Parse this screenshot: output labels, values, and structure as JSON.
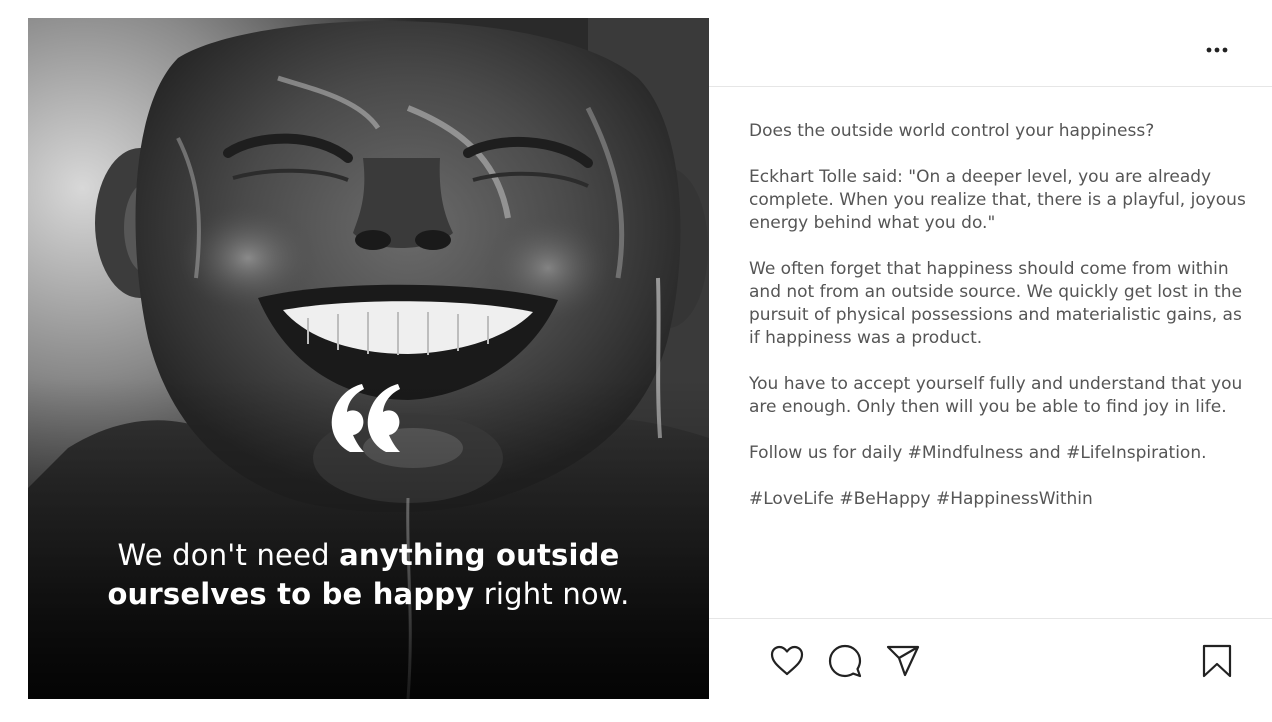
{
  "image": {
    "quote_parts": [
      {
        "text": "We don't need ",
        "weight": "light"
      },
      {
        "text": "anything outside",
        "weight": "bold"
      },
      {
        "text": "ourselves to be happy",
        "weight": "bold"
      },
      {
        "text": " right now.",
        "weight": "light"
      }
    ],
    "quote_icon": "quotation-mark-icon"
  },
  "post": {
    "menu_icon": "more-options-icon",
    "caption": [
      "Does the outside world control your happiness?",
      "Eckhart Tolle said: \"On a deeper level, you are already complete. When you realize that, there is a playful, joyous energy behind what you do.\"",
      "We often forget that happiness should come from within and not from an outside source. We quickly get lost in the pursuit of physical possessions and materialistic gains, as if happiness was a product.",
      "You have to accept yourself fully and understand that you are enough. Only then will you be able to find joy in life.",
      "Follow us for daily #Mindfulness and #LifeInspiration.",
      "#LoveLife #BeHappy #HappinessWithin"
    ],
    "actions": {
      "like_icon": "heart-icon",
      "comment_icon": "comment-bubble-icon",
      "share_icon": "paper-plane-icon",
      "save_icon": "bookmark-icon"
    }
  },
  "colors": {
    "caption_text": "#555555",
    "divider": "#e6e6e6",
    "icon_stroke": "#222222",
    "overlay_text": "#ffffff"
  }
}
